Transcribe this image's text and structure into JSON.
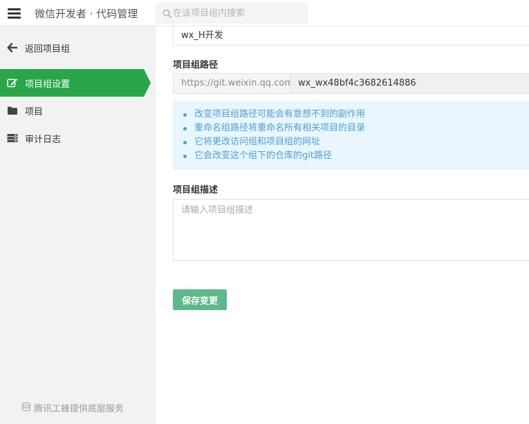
{
  "header": {
    "menu_icon": "hamburger-menu-icon",
    "title": "微信开发者 · 代码管理",
    "search_placeholder": "在该项目组内搜索",
    "search_icon": "search-icon"
  },
  "sidebar": {
    "back_label": "返回项目组",
    "items": [
      {
        "label": "项目组设置",
        "icon": "edit-icon",
        "active": true
      },
      {
        "label": "项目",
        "icon": "folder-icon",
        "active": false
      },
      {
        "label": "审计日志",
        "icon": "server-list-icon",
        "active": false
      }
    ],
    "footer": "腾讯工蜂提供底层服务",
    "active_color": "#2aa54a"
  },
  "form": {
    "group_name_value": "wx_H开发",
    "path_label": "项目组路径",
    "path_prefix": "https://git.weixin.qq.com",
    "path_value": "wx_wx48bf4c3682614886",
    "notices": [
      "改变项目组路径可能会有意想不到的副作用",
      "重命名组路径将重命名所有相关项目的目录",
      "它将更改访问组和项目组的网址",
      "它会改变这个组下的仓库的git路径"
    ],
    "description_label": "项目组描述",
    "description_placeholder": "请输入项目组描述",
    "description_value": "",
    "save_label": "保存变更",
    "save_color": "#5db88a",
    "notice_color": "#4a9fd8"
  }
}
